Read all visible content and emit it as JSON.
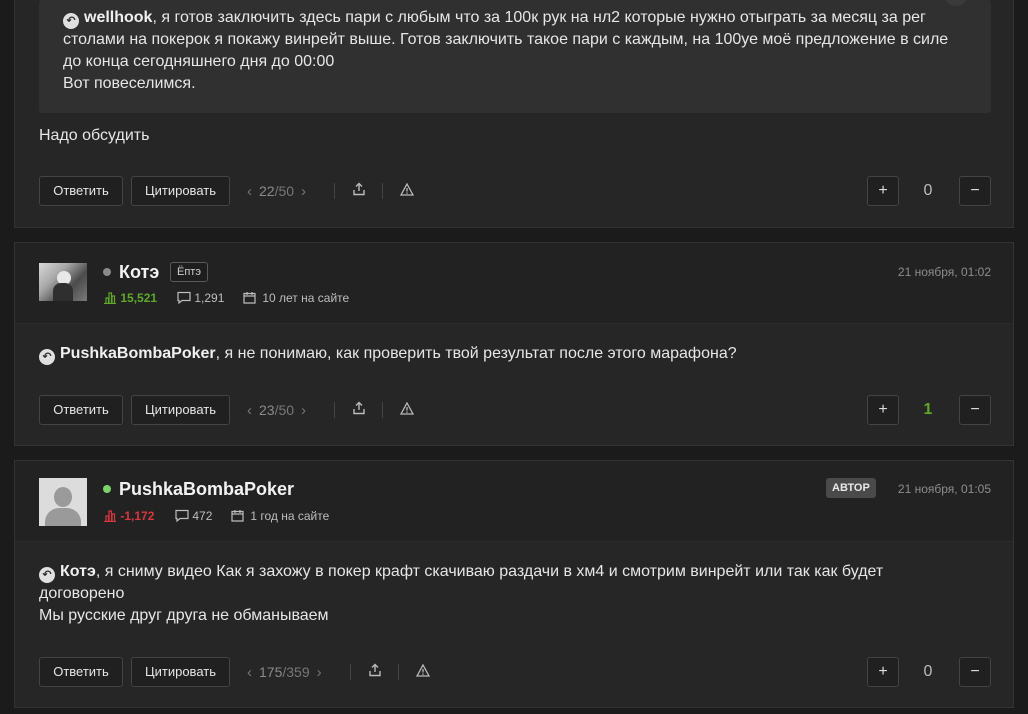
{
  "buttons": {
    "reply": "Ответить",
    "quote": "Цитировать"
  },
  "post1": {
    "quote_author": "wellhook",
    "quote_lines": [
      ", я готов заключить здесь пари с любым что за 100к рук на нл2 которые нужно отыграть за месяц за рег",
      "столами на покерок я покажу винрейт выше. Готов заключить такое пари с каждым, на 100уе моё предложение в силе",
      "до конца сегодняшнего дня до 00:00",
      "Вот повеселимся."
    ],
    "text": "Надо обсудить",
    "page_current": "22",
    "page_total": "/50",
    "score": "0"
  },
  "post2": {
    "username": "Котэ",
    "user_tag": "Ёптэ",
    "date": "21 ноября, 01:02",
    "rating": "15,521",
    "posts": "1,291",
    "tenure": "10 лет на сайте",
    "quote_author": "PushkaBombaPoker",
    "text": ", я не понимаю, как проверить твой результат после этого марафона?",
    "page_current": "23",
    "page_total": "/50",
    "score": "1"
  },
  "post3": {
    "username": "PushkaBombaPoker",
    "author_badge": "АВТОР",
    "date": "21 ноября, 01:05",
    "rating": "-1,172",
    "posts": "472",
    "tenure": "1 год на сайте",
    "quote_author": "Котэ",
    "text_line1": ", я сниму видео Как я захожу в покер крафт скачиваю раздачи в хм4 и смотрим винрейт или так как будет",
    "text_line2": "договорено",
    "text_line3": "Мы русские друг друга не обманываем",
    "page_current": "175",
    "page_total": "/359",
    "score": "0"
  },
  "colors": {
    "rating_positive": "#5fa82a",
    "rating_negative": "#d9363e",
    "online": "#7bd36a",
    "offline": "#8a8a8a",
    "score_positive": "#5fa82a"
  },
  "icons": [
    "reply-icon",
    "chevron-left-icon",
    "chevron-right-icon",
    "share-icon",
    "warning-icon",
    "plus-icon",
    "minus-icon",
    "rating-icon",
    "comment-icon",
    "calendar-icon"
  ]
}
